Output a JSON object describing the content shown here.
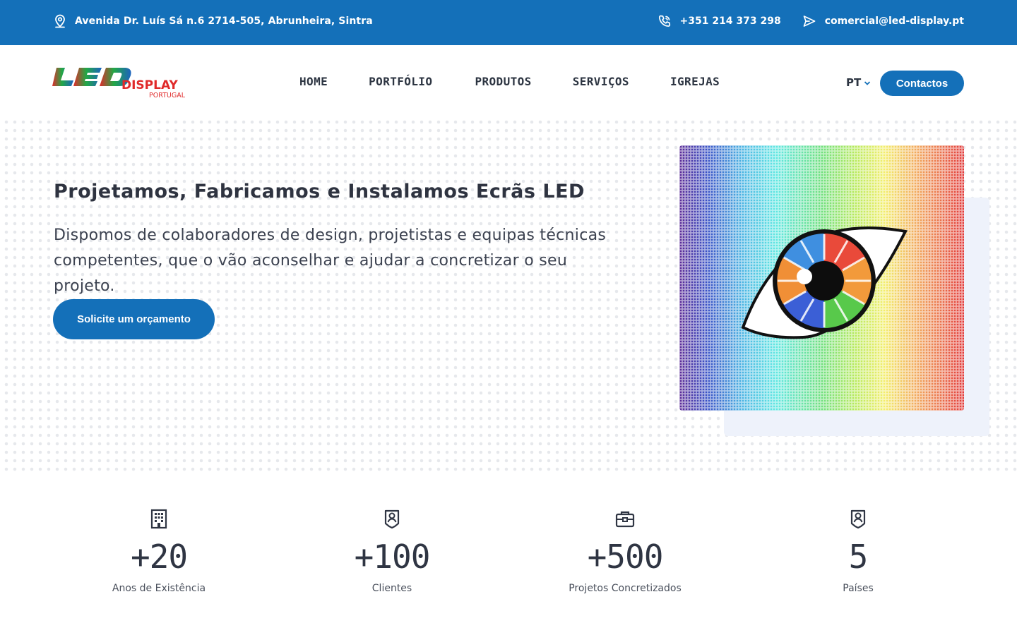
{
  "topbar": {
    "address": "Avenida Dr. Luís Sá n.6 2714-505, Abrunheira, Sintra",
    "phone": "+351 214 373 298",
    "email": "comercial@led-display.pt"
  },
  "header": {
    "logo": {
      "word1": "LED",
      "word2": "DISPLAY",
      "word3": "PORTUGAL"
    },
    "nav": [
      "HOME",
      "PORTFÓLIO",
      "PRODUTOS",
      "SERVIÇOS",
      "IGREJAS"
    ],
    "language": "PT",
    "contact_button": "Contactos"
  },
  "hero": {
    "title": "Projetamos, Fabricamos e Instalamos Ecrãs LED",
    "description": "Dispomos de colaboradores de design, projetistas e equipas técnicas competentes, que o vão aconselhar e ajudar a concretizar o seu projeto.",
    "cta": "Solicite um orçamento"
  },
  "stats": [
    {
      "value": "+20",
      "label": "Anos de Existência",
      "icon": "building-icon"
    },
    {
      "value": "+100",
      "label": "Clientes",
      "icon": "user-badge-icon"
    },
    {
      "value": "+500",
      "label": "Projetos Concretizados",
      "icon": "briefcase-icon"
    },
    {
      "value": "5",
      "label": "Países",
      "icon": "user-badge-icon"
    }
  ],
  "colors": {
    "brand": "#1470b9",
    "text": "#2e3340"
  }
}
